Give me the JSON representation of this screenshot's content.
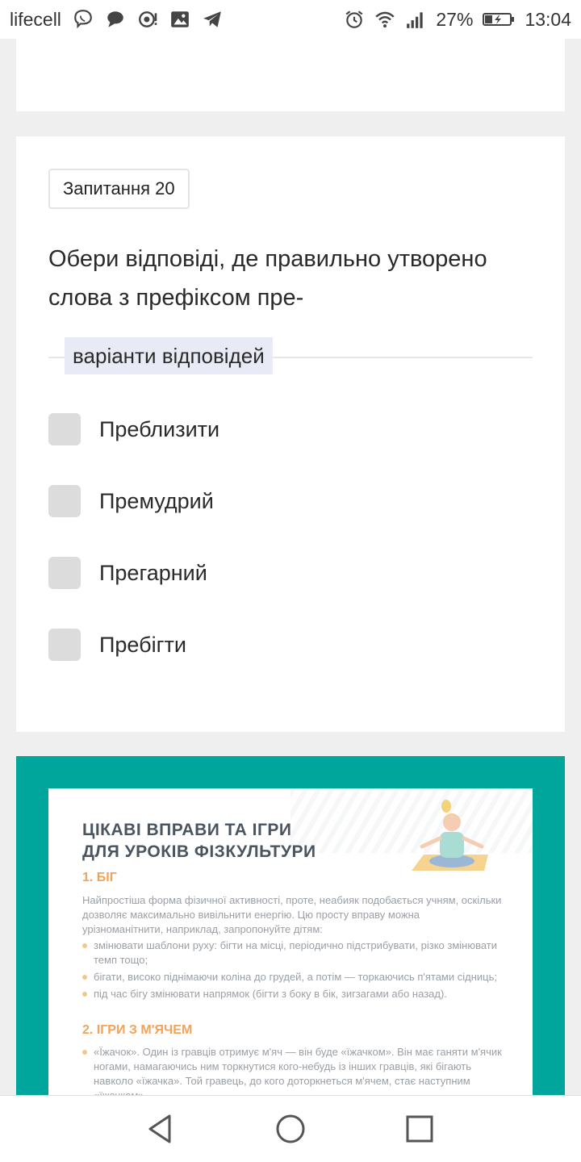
{
  "status_bar": {
    "carrier": "lifecell",
    "battery": "27%",
    "time": "13:04",
    "left_icons": [
      "viber-icon",
      "chat-bubble-icon",
      "camera-notification-icon",
      "gallery-icon",
      "telegram-icon"
    ],
    "right_icons": [
      "alarm-icon",
      "wifi-icon",
      "signal-icon",
      "battery-charging-icon"
    ]
  },
  "question": {
    "badge": "Запитання 20",
    "text": "Обери відповіді, де правильно утворено слова з префіксом пре-",
    "options_header": "варіанти відповідей",
    "options": [
      {
        "label": "Преблизити",
        "checked": false
      },
      {
        "label": "Премудрий",
        "checked": false
      },
      {
        "label": "Прегарний",
        "checked": false
      },
      {
        "label": "Пребігти",
        "checked": false
      }
    ]
  },
  "image_card": {
    "title_line1": "ЦІКАВІ ВПРАВИ ТА ІГРИ",
    "title_line2": "ДЛЯ УРОКІВ ФІЗКУЛЬТУРИ",
    "section1": "1. БІГ",
    "section1_text": "Найпростіша форма фізичної активності, проте, неабияк подобається учням, оскільки дозволяє максимально вивільнити енергію. Цю просту вправу можна урізноманітнити, наприклад, запропонуйте дітям:",
    "section1_bullets": [
      "змінювати шаблони руху: бігти на місці, періодично підстрибувати, різко змінювати темп тощо;",
      "бігати, високо піднімаючи коліна до грудей, а потім — торкаючись п'ятами сідниць;",
      "під час бігу змінювати напрямок (бігти з боку в бік, зигзагами або назад)."
    ],
    "section2": "2. ІГРИ З М'ЯЧЕМ",
    "section2_bullets": [
      "«Їжачок». Один із гравців отримує м'яч — він буде «їжачком». Він має ганяти м'ячик ногами, намагаючись ним торкнутися кого-небудь із інших гравців, які бігають навколо «їжачка». Той гравець, до кого доторкнеться м'ячем, стає наступним «їжачком»."
    ],
    "accent_color": "#00a69c",
    "heading_color": "#f1a35a"
  },
  "nav_bar": {
    "buttons": [
      "back-icon",
      "home-icon",
      "recents-icon"
    ]
  }
}
